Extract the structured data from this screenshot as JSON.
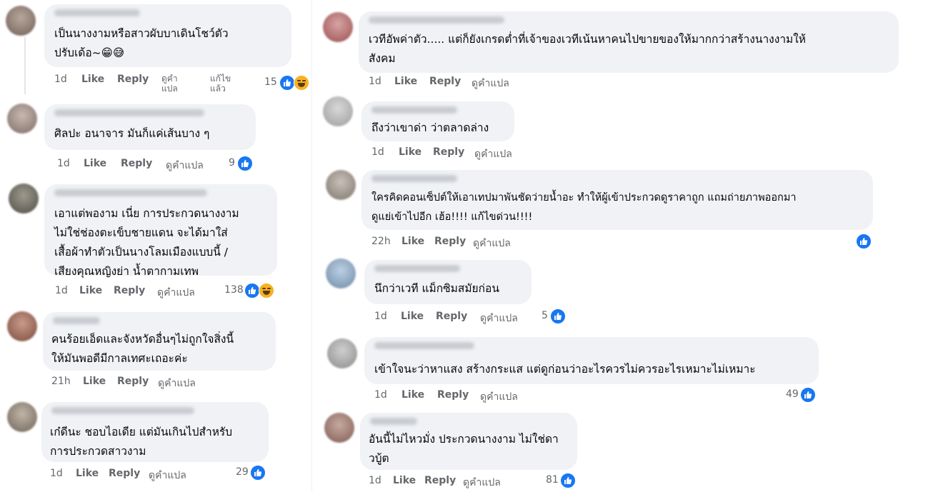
{
  "colors": {
    "bubble": "#f0f2f5",
    "meta_text": "#65676b",
    "like_blue": "#1877f2",
    "haha_yellow": "#f7b125"
  },
  "icons": {
    "like": "like-icon",
    "haha": "haha-icon"
  },
  "actions": {
    "like": "Like",
    "reply": "Reply",
    "translate": "ดูคำแปล",
    "edited": "แก้ไขแล้ว"
  },
  "comments": [
    {
      "text": "เป็นนางงามหรือสาวผับบาเดินโชว์ตัว\nปรับเด้อ~😁😅",
      "time": "1d",
      "count": "15",
      "reactions": [
        "like",
        "haha"
      ]
    },
    {
      "text": "ศิลปะ อนาจาร มันก็แค่เส้นบาง ๆ",
      "time": "1d",
      "count": "9",
      "reactions": [
        "like"
      ]
    },
    {
      "text": "เอาแต่พองาม เนี่ย การประกวดนางงาม\nไม่ใช่ช่องตะเข็บชายแดน จะได้มาใส่\nเสื้อผ้าทำตัวเป็นนางโลมเมืองแบบนี้ /\nเสียงคุณหญิงย่า น้ำตากามเทพ",
      "time": "1d",
      "count": "138",
      "reactions": [
        "like",
        "haha"
      ]
    },
    {
      "text": "คนร้อยเอ็ดและจังหวัดอื่นๆไม่ถูกใจสิ่งนี้\nให้มันพอดีมีกาลเทศะเถอะค่ะ",
      "time": "21h",
      "count": "",
      "reactions": []
    },
    {
      "text": "เก๋ดีนะ ชอบไอเดีย แต่มันเกินไปสำหรับ\nการประกวดสาวงาม",
      "time": "1d",
      "count": "29",
      "reactions": [
        "like"
      ]
    },
    {
      "text": "เวทีอัพค่าตัว..... แต่ก็ยังเกรดต่ำที่เจ้าของเวทีเน้นหาคนไปขายของให้มากกว่าสร้างนางงามให้\nสังคม",
      "time": "1d",
      "count": "",
      "reactions": []
    },
    {
      "text": "ถึงว่าเขาด่า ว่าตลาดล่าง",
      "time": "1d",
      "count": "",
      "reactions": []
    },
    {
      "text": "ใครคิดคอนเซ็ปต์ให้เอาเทปมาพันชัดว่ายน้ำอะ ทำให้ผู้เข้าประกวดดูราคาถูก แถมถ่ายภาพออกมา\nดูแย่เข้าไปอีก เฮ้อ!!!! แก้ไขด่วน!!!!",
      "time": "22h",
      "count": "",
      "reactions": [
        "like"
      ]
    },
    {
      "text": "นึกว่าเวที แม็กซิมสมัยก่อน",
      "time": "1d",
      "count": "5",
      "reactions": [
        "like"
      ]
    },
    {
      "text": "เข้าใจนะว่าหาแสง สร้างกระแส แต่ดูก่อนว่าอะไรควรไม่ควรอะไรเหมาะไม่เหมาะ",
      "time": "1d",
      "count": "49",
      "reactions": [
        "like"
      ]
    },
    {
      "text": "อันนี้ไม่ไหวมั่ง ประกวดนางงาม ไม่ใช่ดา\nวบู้ต",
      "time": "1d",
      "count": "81",
      "reactions": [
        "like"
      ]
    }
  ]
}
